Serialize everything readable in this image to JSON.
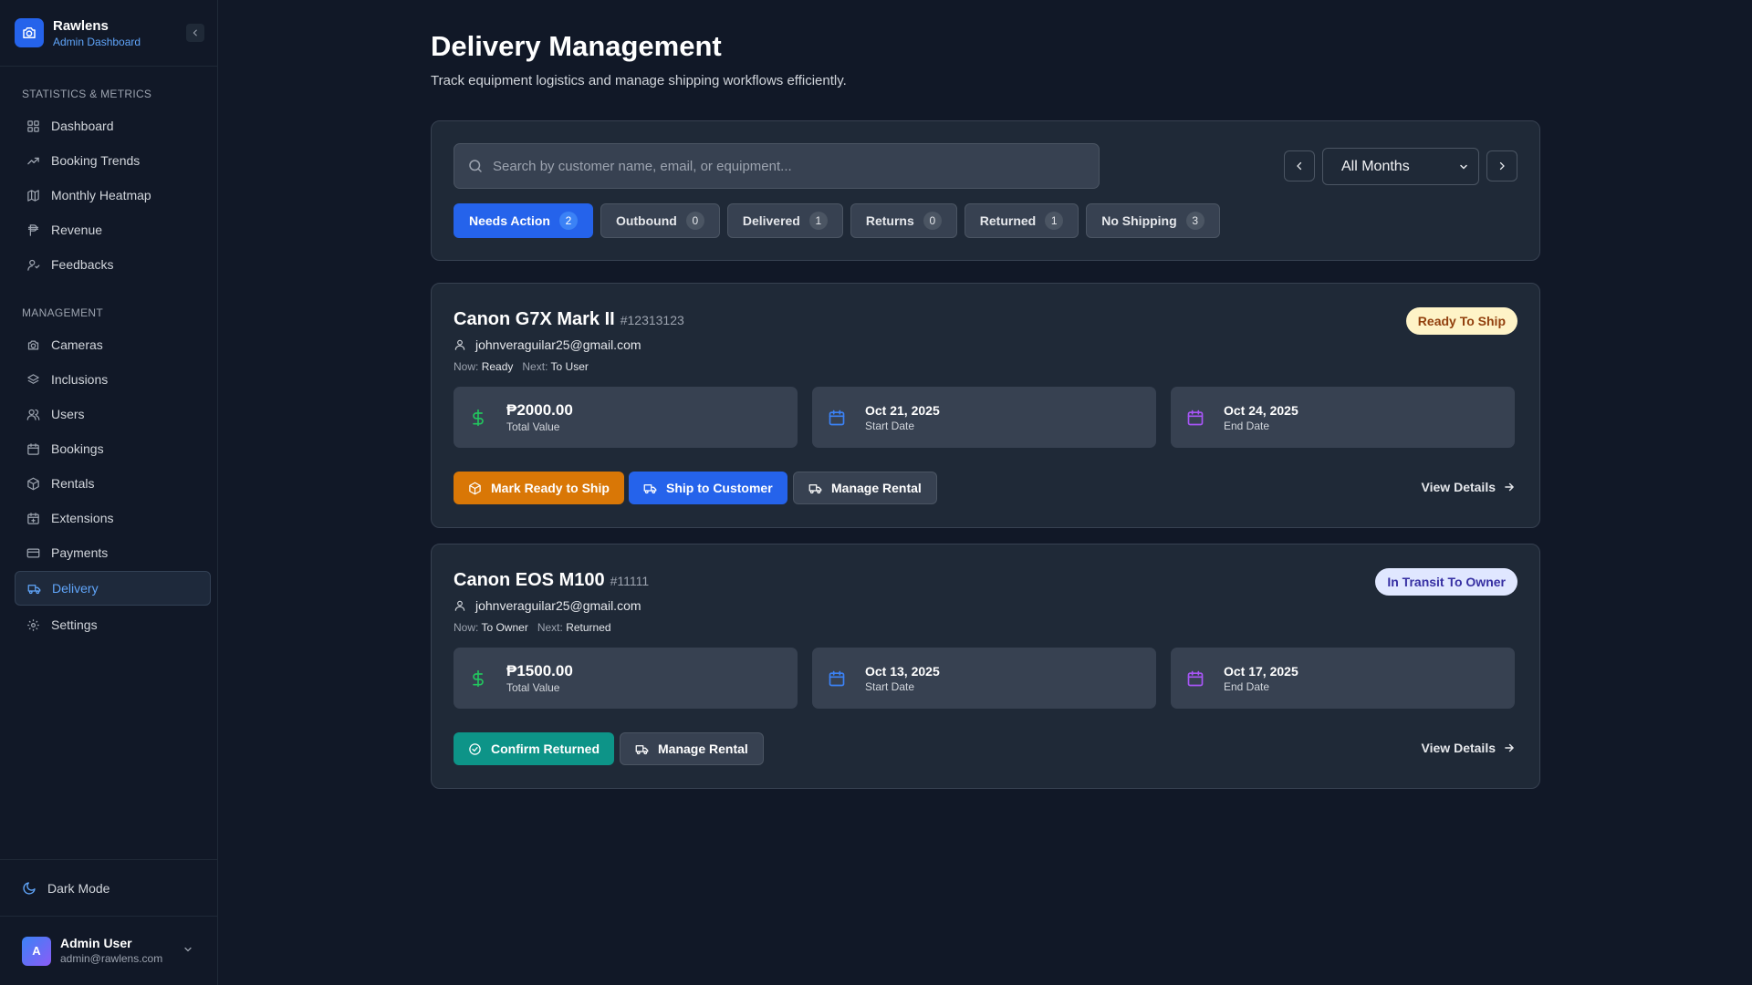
{
  "app": {
    "name": "Rawlens",
    "subtitle": "Admin Dashboard"
  },
  "sidebar": {
    "sections": [
      {
        "title": "STATISTICS & METRICS",
        "items": [
          {
            "label": "Dashboard",
            "icon": "grid-icon"
          },
          {
            "label": "Booking Trends",
            "icon": "trending-up-icon"
          },
          {
            "label": "Monthly Heatmap",
            "icon": "map-icon"
          },
          {
            "label": "Revenue",
            "icon": "peso-icon"
          },
          {
            "label": "Feedbacks",
            "icon": "user-feedback-icon"
          }
        ]
      },
      {
        "title": "MANAGEMENT",
        "items": [
          {
            "label": "Cameras",
            "icon": "camera-icon"
          },
          {
            "label": "Inclusions",
            "icon": "layers-icon"
          },
          {
            "label": "Users",
            "icon": "users-icon"
          },
          {
            "label": "Bookings",
            "icon": "calendar-icon"
          },
          {
            "label": "Rentals",
            "icon": "box-icon"
          },
          {
            "label": "Extensions",
            "icon": "calendar-plus-icon"
          },
          {
            "label": "Payments",
            "icon": "credit-card-icon"
          },
          {
            "label": "Delivery",
            "icon": "truck-icon",
            "active": true
          },
          {
            "label": "Settings",
            "icon": "gear-icon"
          }
        ]
      }
    ],
    "dark_mode_label": "Dark Mode",
    "user": {
      "initial": "A",
      "name": "Admin User",
      "email": "admin@rawlens.com"
    }
  },
  "page": {
    "title": "Delivery Management",
    "subtitle": "Track equipment logistics and manage shipping workflows efficiently."
  },
  "filters": {
    "search_placeholder": "Search by customer name, email, or equipment...",
    "month_selected": "All Months",
    "tabs": [
      {
        "label": "Needs Action",
        "count": "2",
        "active": true
      },
      {
        "label": "Outbound",
        "count": "0"
      },
      {
        "label": "Delivered",
        "count": "1"
      },
      {
        "label": "Returns",
        "count": "0"
      },
      {
        "label": "Returned",
        "count": "1"
      },
      {
        "label": "No Shipping",
        "count": "3"
      }
    ]
  },
  "colors": {
    "accent": "#2563eb",
    "orange": "#d97706",
    "teal": "#0d9488",
    "success": "#22c55e",
    "blue_icon": "#3b82f6",
    "purple_icon": "#a855f7"
  },
  "orders": [
    {
      "name": "Canon G7X Mark II",
      "id": "#12313123",
      "status": "Ready To Ship",
      "status_style": "amber",
      "email": "johnveraguilar25@gmail.com",
      "now_label": "Now:",
      "now": "Ready",
      "next_label": "Next:",
      "next": "To User",
      "total": "₱2000.00",
      "total_label": "Total Value",
      "start": "Oct 21, 2025",
      "start_label": "Start Date",
      "end": "Oct 24, 2025",
      "end_label": "End Date",
      "actions": [
        {
          "label": "Mark Ready to Ship",
          "style": "orange",
          "icon": "package-icon"
        },
        {
          "label": "Ship to Customer",
          "style": "blue",
          "icon": "truck-icon"
        },
        {
          "label": "Manage Rental",
          "style": "gray",
          "icon": "truck-icon"
        }
      ],
      "view_details": "View Details"
    },
    {
      "name": "Canon EOS M100",
      "id": "#11111",
      "status": "In Transit To Owner",
      "status_style": "indigo",
      "email": "johnveraguilar25@gmail.com",
      "now_label": "Now:",
      "now": "To Owner",
      "next_label": "Next:",
      "next": "Returned",
      "total": "₱1500.00",
      "total_label": "Total Value",
      "start": "Oct 13, 2025",
      "start_label": "Start Date",
      "end": "Oct 17, 2025",
      "end_label": "End Date",
      "actions": [
        {
          "label": "Confirm Returned",
          "style": "teal",
          "icon": "check-circle-icon"
        },
        {
          "label": "Manage Rental",
          "style": "gray",
          "icon": "truck-icon"
        }
      ],
      "view_details": "View Details"
    }
  ]
}
